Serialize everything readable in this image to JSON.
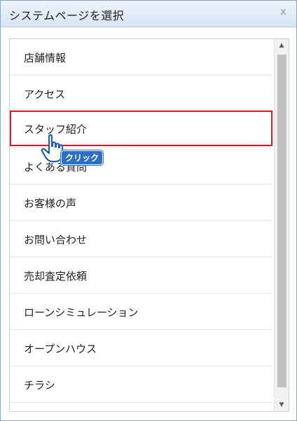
{
  "dialog": {
    "title": "システムページを選択",
    "close_label": "x"
  },
  "list": {
    "items": [
      {
        "label": "店舗情報"
      },
      {
        "label": "アクセス"
      },
      {
        "label": "スタッフ紹介"
      },
      {
        "label": "よくある質問"
      },
      {
        "label": "お客様の声"
      },
      {
        "label": "お問い合わせ"
      },
      {
        "label": "売却査定依頼"
      },
      {
        "label": "ローンシミュレーション"
      },
      {
        "label": "オープンハウス"
      },
      {
        "label": "チラシ"
      }
    ],
    "highlighted_index": 2
  },
  "annotation": {
    "click_label": "クリック"
  },
  "scrollbar": {
    "up_icon": "triangle-up-icon",
    "down_icon": "triangle-down-icon"
  },
  "colors": {
    "highlight_border": "#d91a2a",
    "badge_bg": "#2d6fc2"
  }
}
